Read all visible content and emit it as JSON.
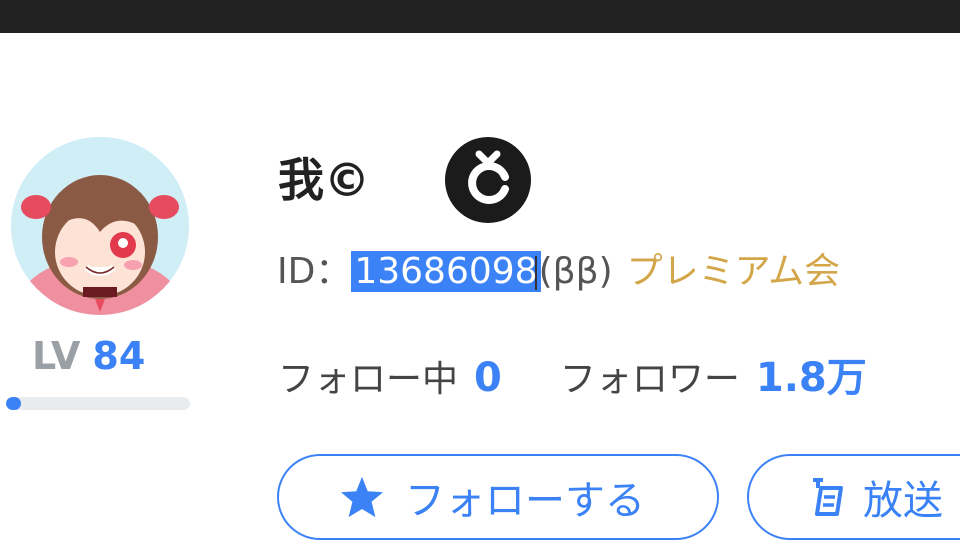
{
  "profile": {
    "name": "我©",
    "id_label": "ID：",
    "id_value": "13686098",
    "id_suffix": "(ββ)",
    "premium_label": "プレミアム会",
    "level_label": "LV",
    "level_value": "84",
    "level_progress_fraction": 0.08,
    "following_label": "フォロー中",
    "following_count": "0",
    "followers_label": "フォロワー",
    "followers_count": "1.8万"
  },
  "buttons": {
    "follow_label": "フォローする",
    "broadcast_label": "放送"
  },
  "icons": {
    "badge": "c-letter-badge-icon",
    "follow": "star-icon",
    "broadcast": "broadcast-icon"
  },
  "colors": {
    "accent": "#3b82f6",
    "premium": "#d4a64a",
    "topbar": "#222222"
  }
}
